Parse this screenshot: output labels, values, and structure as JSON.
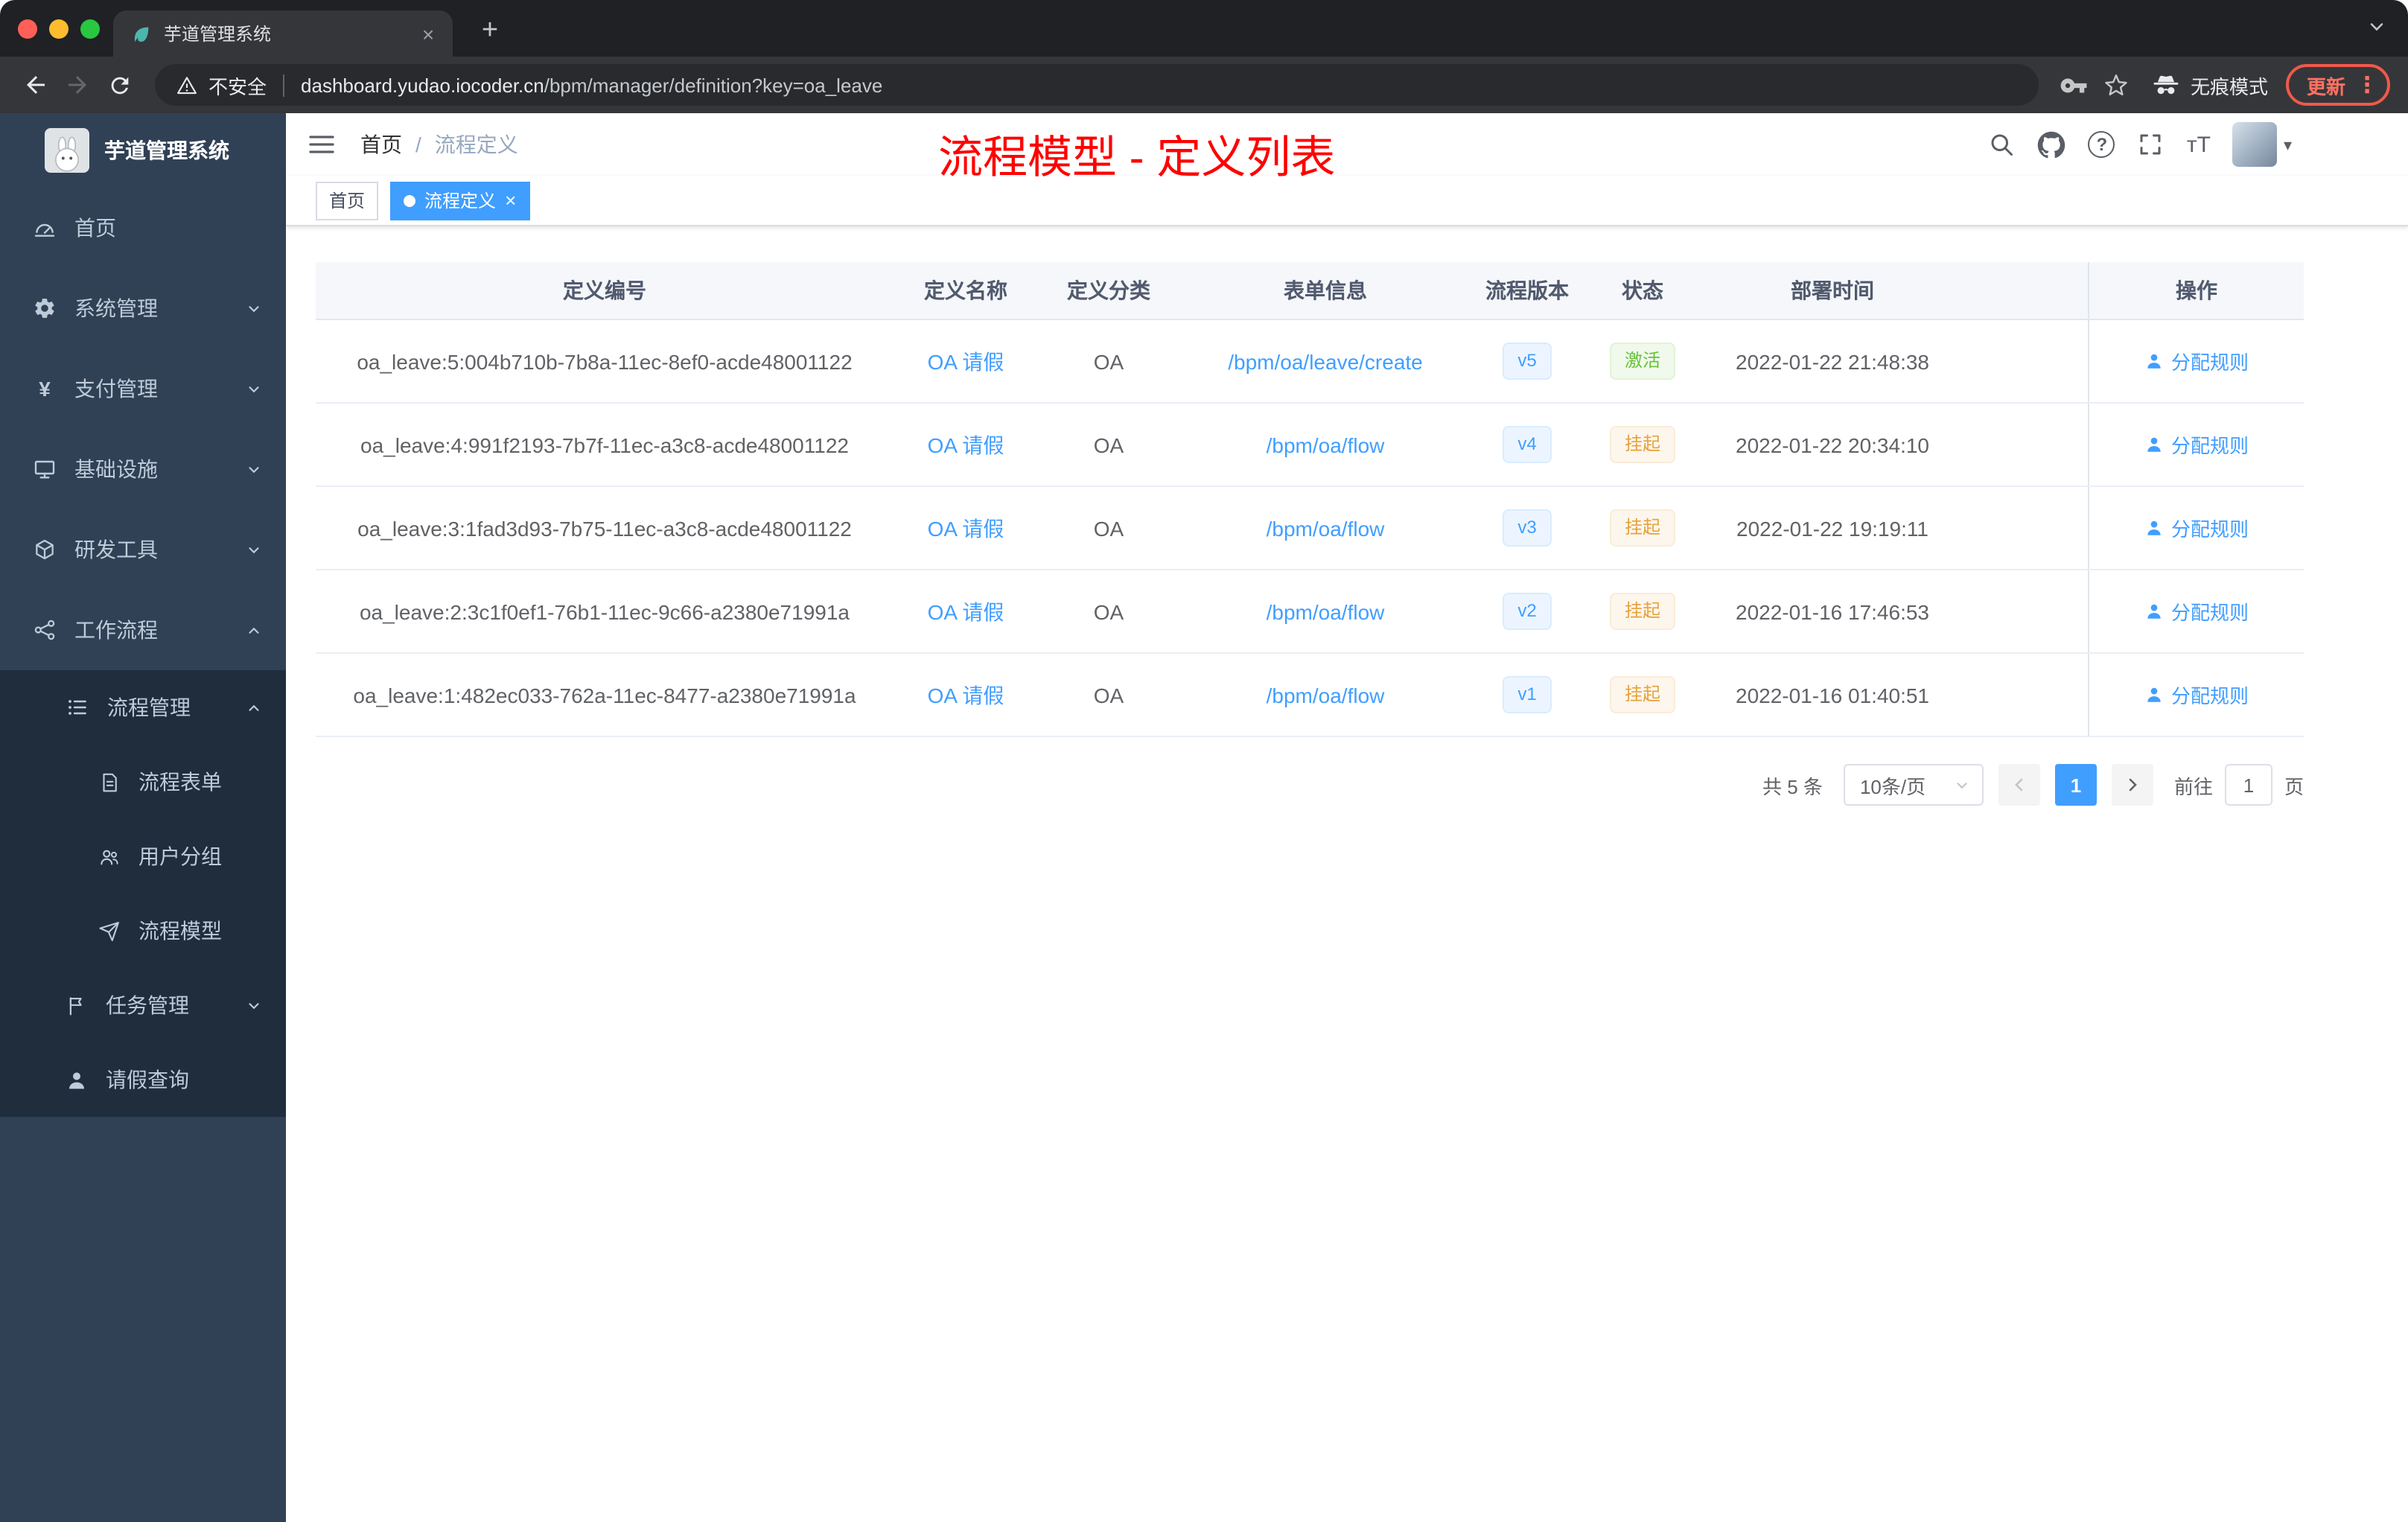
{
  "colors": {
    "accent": "#409eff",
    "success": "#67c23a",
    "warning": "#e6a23c",
    "annotation": "#ff0000",
    "sidebar_bg": "#304156",
    "submenu_bg": "#1f2d3d"
  },
  "browser": {
    "tab_title": "芋道管理系统",
    "security_label": "不安全",
    "url_host": "dashboard.yudao.iocoder.cn",
    "url_path": "/bpm/manager/definition?key=oa_leave",
    "incognito_label": "无痕模式",
    "update_label": "更新"
  },
  "icons": {
    "plus": "+",
    "close": "×",
    "dots": "⋮",
    "caret": "▾",
    "question": "?",
    "font_size": "тT",
    "yen": "¥"
  },
  "sidebar": {
    "app_title": "芋道管理系统",
    "items": [
      {
        "label": "首页"
      },
      {
        "label": "系统管理"
      },
      {
        "label": "支付管理"
      },
      {
        "label": "基础设施"
      },
      {
        "label": "研发工具"
      },
      {
        "label": "工作流程"
      },
      {
        "label": "流程管理"
      },
      {
        "label": "流程表单"
      },
      {
        "label": "用户分组"
      },
      {
        "label": "流程模型"
      },
      {
        "label": "任务管理"
      },
      {
        "label": "请假查询"
      }
    ]
  },
  "header": {
    "breadcrumb_home": "首页",
    "breadcrumb_sep": "/",
    "breadcrumb_current": "流程定义",
    "annotation": "流程模型 - 定义列表"
  },
  "tags": {
    "home": "首页",
    "current": "流程定义"
  },
  "table": {
    "columns": [
      "定义编号",
      "定义名称",
      "定义分类",
      "表单信息",
      "流程版本",
      "状态",
      "部署时间",
      "操作"
    ],
    "rows": [
      {
        "id": "oa_leave:5:004b710b-7b8a-11ec-8ef0-acde48001122",
        "name": "OA 请假",
        "category": "OA",
        "form": "/bpm/oa/leave/create",
        "version": "v5",
        "status": "激活",
        "status_type": "success",
        "time": "2022-01-22 21:48:38",
        "action": "分配规则"
      },
      {
        "id": "oa_leave:4:991f2193-7b7f-11ec-a3c8-acde48001122",
        "name": "OA 请假",
        "category": "OA",
        "form": "/bpm/oa/flow",
        "version": "v4",
        "status": "挂起",
        "status_type": "warning",
        "time": "2022-01-22 20:34:10",
        "action": "分配规则"
      },
      {
        "id": "oa_leave:3:1fad3d93-7b75-11ec-a3c8-acde48001122",
        "name": "OA 请假",
        "category": "OA",
        "form": "/bpm/oa/flow",
        "version": "v3",
        "status": "挂起",
        "status_type": "warning",
        "time": "2022-01-22 19:19:11",
        "action": "分配规则"
      },
      {
        "id": "oa_leave:2:3c1f0ef1-76b1-11ec-9c66-a2380e71991a",
        "name": "OA 请假",
        "category": "OA",
        "form": "/bpm/oa/flow",
        "version": "v2",
        "status": "挂起",
        "status_type": "warning",
        "time": "2022-01-16 17:46:53",
        "action": "分配规则"
      },
      {
        "id": "oa_leave:1:482ec033-762a-11ec-8477-a2380e71991a",
        "name": "OA 请假",
        "category": "OA",
        "form": "/bpm/oa/flow",
        "version": "v1",
        "status": "挂起",
        "status_type": "warning",
        "time": "2022-01-16 01:40:51",
        "action": "分配规则"
      }
    ]
  },
  "pagination": {
    "total": "共 5 条",
    "page_size": "10条/页",
    "current_page": "1",
    "goto_label": "前往",
    "goto_value": "1",
    "goto_unit": "页"
  }
}
